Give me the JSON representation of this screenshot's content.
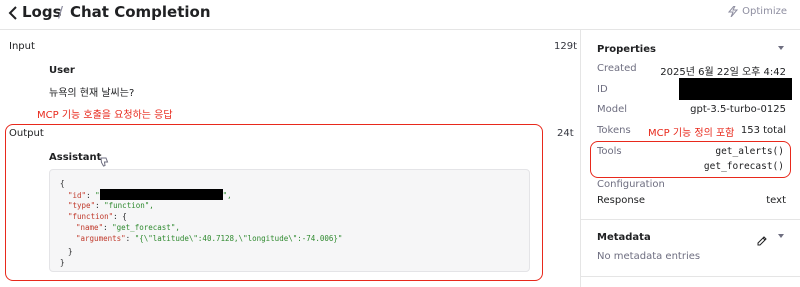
{
  "header": {
    "back_icon": "chevron-left-icon",
    "crumb_logs": "Logs",
    "separator": "/",
    "title": "Chat Completion",
    "optimize_label": "Optimize",
    "optimize_icon": "lightning-icon"
  },
  "input": {
    "label": "Input",
    "tokens": "129t",
    "sender": "User",
    "message": "뉴욕의 현재 날씨는?"
  },
  "annotations": {
    "response": "MCP 기능 호출을 요청하는 응답",
    "tools": "MCP 기능 정의 포함",
    "color": "#e8291c"
  },
  "output": {
    "label": "Output",
    "tokens": "24t",
    "sender": "Assistant",
    "feedback_icon": "thumbs-down-icon",
    "code": {
      "open": "{",
      "id_key": "\"id\"",
      "id_value_open": "\"",
      "id_value_close": "\",",
      "type_key": "\"type\"",
      "type_value": "\"function\",",
      "function_key": "\"function\"",
      "function_open": "{",
      "name_key": "\"name\"",
      "name_value": "\"get_forecast\",",
      "arguments_key": "\"arguments\"",
      "arguments_value": "\"{\\\"latitude\\\":40.7128,\\\"longitude\\\":-74.006}\"",
      "inner_close": "}",
      "close": "}",
      "colon": ": "
    }
  },
  "properties": {
    "title": "Properties",
    "created_label": "Created",
    "created_value": "2025년 6월 22일 오후 4:42",
    "id_label": "ID",
    "model_label": "Model",
    "model_value": "gpt-3.5-turbo-0125",
    "tokens_label": "Tokens",
    "tokens_value": "153 total",
    "tools_label": "Tools",
    "tools": [
      "get_alerts()",
      "get_forecast()"
    ],
    "configuration_label": "Configuration",
    "response_label": "Response",
    "response_value": "text"
  },
  "metadata": {
    "title": "Metadata",
    "edit_icon": "pencil-icon",
    "empty_text": "No metadata entries"
  }
}
